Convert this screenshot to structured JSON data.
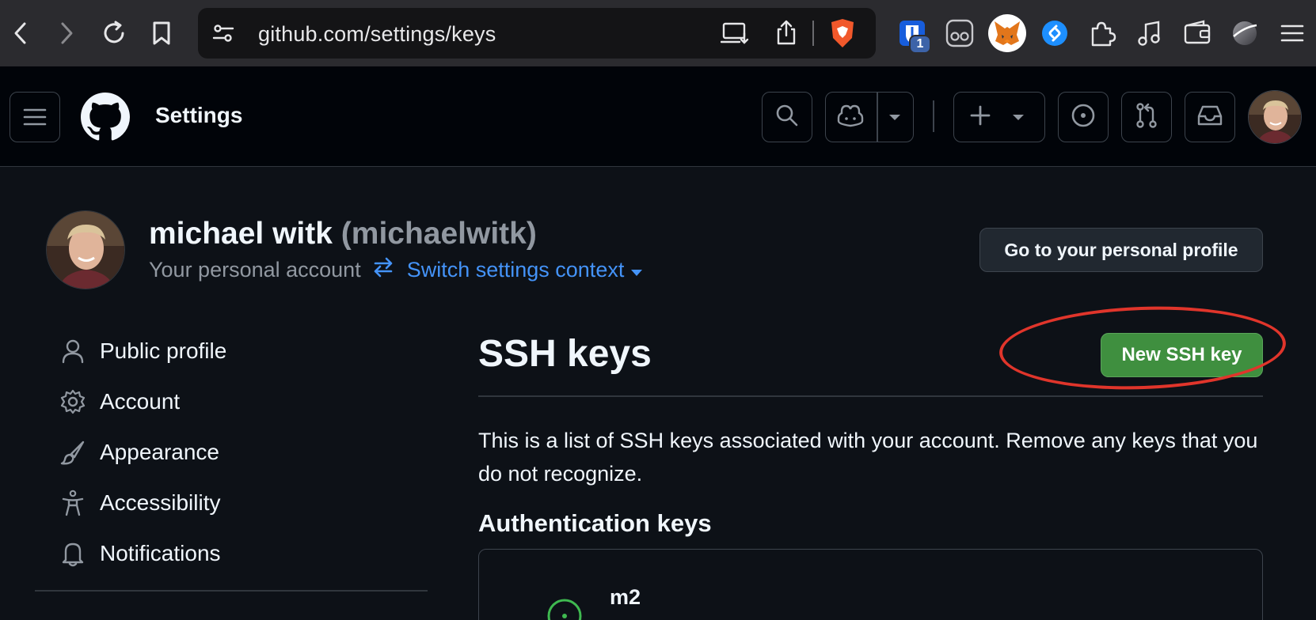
{
  "browser": {
    "url": "github.com/settings/keys",
    "extension_badge": "1",
    "colors": {
      "chrome": "#2b2b2f",
      "urlbar": "#141416"
    },
    "icons": [
      "back-icon",
      "forward-icon",
      "reload-icon",
      "bookmark-icon",
      "site-settings-icon",
      "install-app-icon",
      "share-icon",
      "brave-shield-icon",
      "bitwarden-icon",
      "reader-icon",
      "metamask-icon",
      "shazam-icon",
      "extensions-icon",
      "media-icon",
      "wallet-icon",
      "leo-icon",
      "menu-icon"
    ]
  },
  "header": {
    "title": "Settings",
    "icons": [
      "hamburger-icon",
      "github-logo-icon",
      "search-icon",
      "copilot-icon",
      "plus-icon",
      "issues-icon",
      "pull-requests-icon",
      "inbox-icon"
    ]
  },
  "account": {
    "display_name": "michael witk",
    "login": "(michaelwitk)",
    "subtitle": "Your personal account",
    "switch_context": "Switch settings context",
    "profile_button": "Go to your personal profile"
  },
  "sidebar": {
    "items": [
      {
        "label": "Public profile",
        "icon": "person-icon"
      },
      {
        "label": "Account",
        "icon": "gear-icon"
      },
      {
        "label": "Appearance",
        "icon": "paintbrush-icon"
      },
      {
        "label": "Accessibility",
        "icon": "accessibility-icon"
      },
      {
        "label": "Notifications",
        "icon": "bell-icon"
      }
    ]
  },
  "main": {
    "title": "SSH keys",
    "new_key_button": "New SSH key",
    "description": "This is a list of SSH keys associated with your account. Remove any keys that you do not recognize.",
    "section_title": "Authentication keys",
    "keys": [
      {
        "name": "m2"
      }
    ],
    "colors": {
      "primary_button": "#3f8f3f",
      "highlight": "#e0352b",
      "link": "#4493f8"
    }
  }
}
